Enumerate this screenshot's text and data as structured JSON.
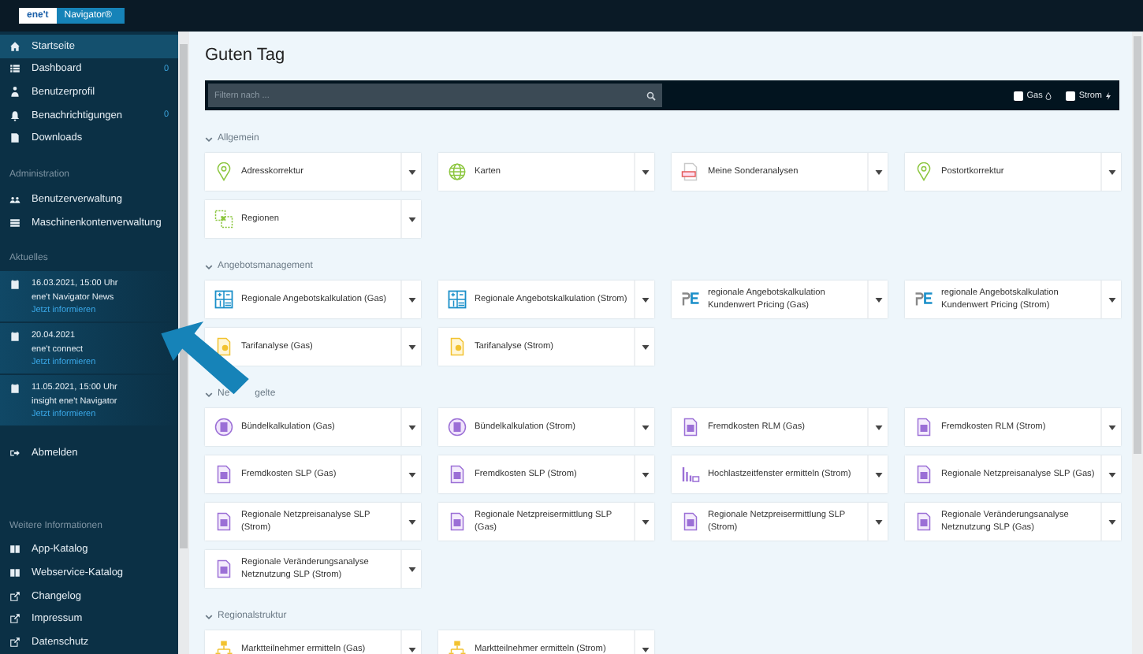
{
  "topbar": {
    "logo": "ene't",
    "product": "Navigator®"
  },
  "sidebar": {
    "items": [
      {
        "label": "Startseite",
        "selected": true
      },
      {
        "label": "Dashboard",
        "badge": "0",
        "selected": false
      },
      {
        "label": "Benutzerprofil",
        "selected": false
      },
      {
        "label": "Benachrichtigungen",
        "badge": "0",
        "selected": false
      },
      {
        "label": "Downloads",
        "selected": false
      }
    ],
    "admin_heading": "Administration",
    "admin_items": [
      "Benutzerverwaltung",
      "Maschinenkontenverwaltung"
    ],
    "news_heading": "Aktuelles",
    "news": [
      {
        "date": "16.03.2021, 15:00 Uhr",
        "title": "ene't Navigator News",
        "link": "Jetzt informieren"
      },
      {
        "date": "20.04.2021",
        "title": "ene't connect",
        "link": "Jetzt informieren"
      },
      {
        "date": "11.05.2021, 15:00 Uhr",
        "title": "insight ene't Navigator",
        "link": "Jetzt informieren"
      }
    ],
    "logout": "Abmelden",
    "info_heading": "Weitere Informationen",
    "info_items": [
      {
        "label": "App-Katalog",
        "kind": "book"
      },
      {
        "label": "Webservice-Katalog",
        "kind": "book"
      },
      {
        "label": "Changelog",
        "kind": "link"
      },
      {
        "label": "Impressum",
        "kind": "link"
      },
      {
        "label": "Datenschutz",
        "kind": "link"
      }
    ]
  },
  "page_title": "Guten Tag",
  "filter": {
    "placeholder": "Filtern nach ...",
    "options": [
      {
        "label": "Gas",
        "checked": false,
        "kind": "gas"
      },
      {
        "label": "Strom",
        "checked": false,
        "kind": "strom"
      }
    ]
  },
  "sections": [
    {
      "title": "Allgemein",
      "tiles": [
        {
          "label": "Adresskorrektur",
          "kind": "pin"
        },
        {
          "label": "Karten",
          "kind": "globe"
        },
        {
          "label": "Meine Sonderanalysen",
          "kind": "report"
        },
        {
          "label": "Postortkorrektur",
          "kind": "pin"
        },
        {
          "label": "Regionen",
          "kind": "regions"
        }
      ]
    },
    {
      "title": "Angebotsmanagement",
      "tiles": [
        {
          "label": "Regionale Angebotskalkulation (Gas)",
          "kind": "calc"
        },
        {
          "label": "Regionale Angebotskalkulation (Strom)",
          "kind": "calc"
        },
        {
          "label": "regionale Angebotskalkulation Kundenwert Pricing (Gas)",
          "kind": "pe"
        },
        {
          "label": "regionale Angebotskalkulation Kundenwert Pricing (Strom)",
          "kind": "pe"
        },
        {
          "label": "Tarifanalyse (Gas)",
          "kind": "tariff"
        },
        {
          "label": "Tarifanalyse (Strom)",
          "kind": "tariff"
        }
      ]
    },
    {
      "title_parts": [
        "Ne",
        "gelte"
      ],
      "tiles": [
        {
          "label": "Bündelkalkulation (Gas)",
          "kind": "bundle"
        },
        {
          "label": "Bündelkalkulation (Strom)",
          "kind": "bundle"
        },
        {
          "label": "Fremdkosten RLM (Gas)",
          "kind": "doc"
        },
        {
          "label": "Fremdkosten RLM (Strom)",
          "kind": "doc"
        },
        {
          "label": "Fremdkosten SLP (Gas)",
          "kind": "doc"
        },
        {
          "label": "Fremdkosten SLP (Strom)",
          "kind": "doc"
        },
        {
          "label": "Hochlastzeitfenster ermitteln (Strom)",
          "kind": "chart"
        },
        {
          "label": "Regionale Netzpreisanalyse SLP (Gas)",
          "kind": "doc"
        },
        {
          "label": "Regionale Netzpreisanalyse SLP (Strom)",
          "kind": "doc"
        },
        {
          "label": "Regionale Netzpreisermittlung SLP (Gas)",
          "kind": "doc"
        },
        {
          "label": "Regionale Netzpreisermittlung SLP (Strom)",
          "kind": "doc"
        },
        {
          "label": "Regionale Veränderungsanalyse Netznutzung SLP (Gas)",
          "kind": "doc"
        },
        {
          "label": "Regionale Veränderungsanalyse Netznutzung SLP (Strom)",
          "kind": "doc"
        }
      ]
    },
    {
      "title": "Regionalstruktur",
      "tiles": [
        {
          "label": "Marktteilnehmer ermitteln (Gas)",
          "kind": "org"
        },
        {
          "label": "Marktteilnehmer ermitteln (Strom)",
          "kind": "org"
        }
      ]
    }
  ]
}
